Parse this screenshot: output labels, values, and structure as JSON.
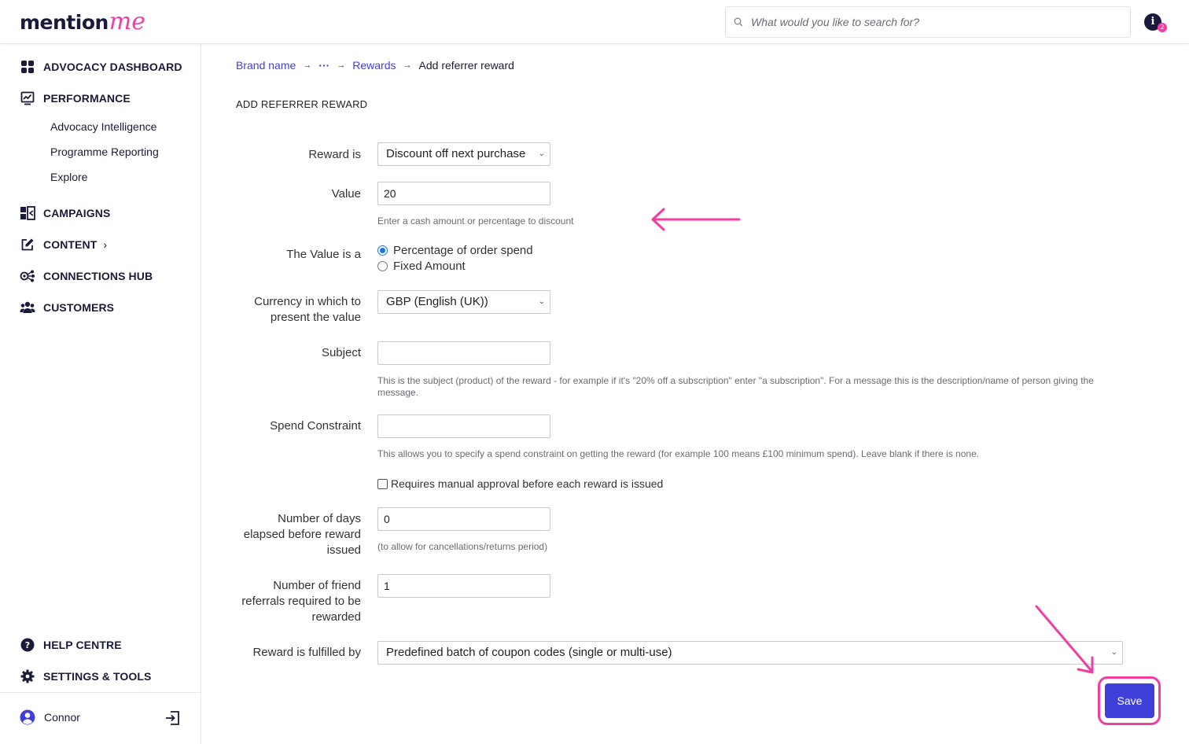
{
  "header": {
    "logo_main": "mention",
    "logo_accent": "me",
    "search_placeholder": "What would you like to search for?",
    "info_label": "i",
    "notification_count": "2"
  },
  "sidebar": {
    "items": [
      {
        "label": "ADVOCACY DASHBOARD",
        "icon": "grid-icon"
      },
      {
        "label": "PERFORMANCE",
        "icon": "chart-icon"
      },
      {
        "label": "CAMPAIGNS",
        "icon": "campaign-icon"
      },
      {
        "label": "CONTENT",
        "icon": "edit-icon",
        "chevron": "›"
      },
      {
        "label": "CONNECTIONS HUB",
        "icon": "connections-icon"
      },
      {
        "label": "CUSTOMERS",
        "icon": "users-icon"
      }
    ],
    "performance_sub": [
      "Advocacy Intelligence",
      "Programme Reporting",
      "Explore"
    ],
    "bottom_items": [
      {
        "label": "HELP CENTRE",
        "icon": "help-icon"
      },
      {
        "label": "SETTINGS & TOOLS",
        "icon": "gear-icon"
      }
    ],
    "user_name": "Connor"
  },
  "breadcrumb": {
    "brand": "Brand name",
    "ellipsis": "···",
    "rewards": "Rewards",
    "current": "Add referrer reward",
    "separator": "→"
  },
  "page_title": "ADD REFERRER REWARD",
  "form": {
    "reward_is": {
      "label": "Reward is",
      "value": "Discount off next purchase"
    },
    "value": {
      "label": "Value",
      "value": "20",
      "help": "Enter a cash amount or percentage to discount"
    },
    "value_type": {
      "label": "The Value is a",
      "options": [
        "Percentage of order spend",
        "Fixed Amount"
      ],
      "selected": 0
    },
    "currency": {
      "label_line1": "Currency in which to",
      "label_line2": "present the value",
      "value": "GBP (English (UK))"
    },
    "subject": {
      "label": "Subject",
      "value": "",
      "help": "This is the subject (product) of the reward - for example if it's \"20% off a subscription\" enter \"a subscription\". For a message this is the description/name of person giving the message."
    },
    "spend_constraint": {
      "label": "Spend Constraint",
      "value": "",
      "help": "This allows you to specify a spend constraint on getting the reward (for example 100 means £100 minimum spend). Leave blank if there is none."
    },
    "manual_approval": {
      "label": "Requires manual approval before each reward is issued",
      "checked": false
    },
    "days_elapsed": {
      "label_line1": "Number of days",
      "label_line2": "elapsed before reward",
      "label_line3": "issued",
      "value": "0",
      "help": "(to allow for cancellations/returns period)"
    },
    "friend_referrals": {
      "label_line1": "Number of friend",
      "label_line2": "referrals required to be",
      "label_line3": "rewarded",
      "value": "1"
    },
    "fulfilled_by": {
      "label": "Reward is fulfilled by",
      "value": "Predefined batch of coupon codes (single or multi-use)"
    }
  },
  "save_label": "Save",
  "colors": {
    "accent": "#3f40d9",
    "highlight": "#f23ea0",
    "text": "#1a1a3a"
  }
}
